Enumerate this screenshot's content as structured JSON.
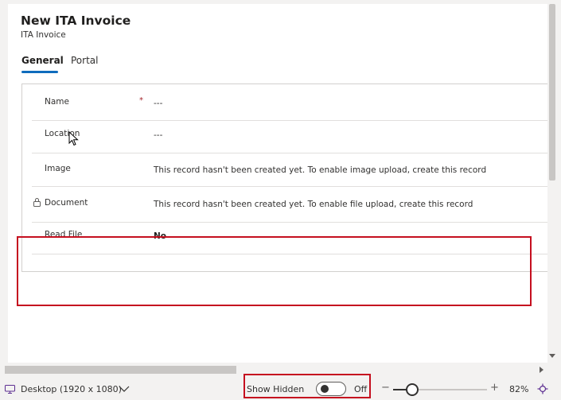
{
  "header": {
    "title": "New ITA Invoice",
    "subtitle": "ITA Invoice"
  },
  "tabs": [
    {
      "label": "General",
      "selected": true
    },
    {
      "label": "Portal",
      "selected": false
    }
  ],
  "form": {
    "fields": [
      {
        "label": "Name",
        "required_mark": "*",
        "value": "---"
      },
      {
        "label": "Location",
        "value": "---"
      },
      {
        "label": "Image",
        "value": "This record hasn't been created yet. To enable image upload, create this record"
      },
      {
        "label": "Document",
        "locked": true,
        "value": "This record hasn't been created yet. To enable file upload, create this record"
      },
      {
        "label": "Read File",
        "value": "No"
      }
    ]
  },
  "bottom_bar": {
    "device": "Desktop (1920 x 1080)",
    "show_hidden_label": "Show Hidden",
    "show_hidden_state": "Off",
    "zoom_minus": "−",
    "zoom_plus": "+",
    "zoom_label": "82%",
    "zoom_level_fraction": 0.2
  },
  "colors": {
    "accent": "#0f6cbd",
    "highlight": "#c50f1f",
    "required": "#a4262c"
  }
}
